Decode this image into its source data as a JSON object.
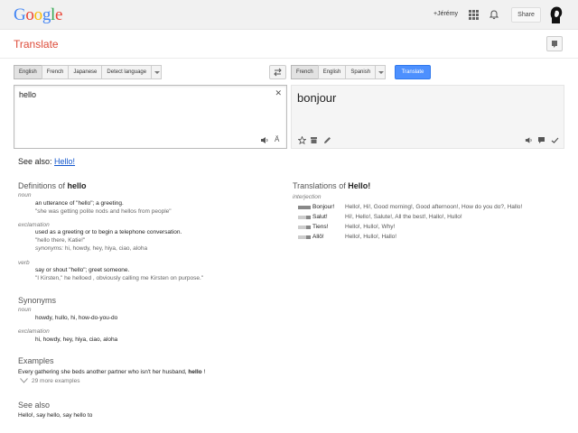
{
  "topbar": {
    "logo_letters": [
      {
        "ch": "G",
        "color": "#4285f4"
      },
      {
        "ch": "o",
        "color": "#ea4335"
      },
      {
        "ch": "o",
        "color": "#fbbc05"
      },
      {
        "ch": "g",
        "color": "#4285f4"
      },
      {
        "ch": "l",
        "color": "#34a853"
      },
      {
        "ch": "e",
        "color": "#ea4335"
      }
    ],
    "user_link": "+Jérémy",
    "share_label": "Share"
  },
  "header": {
    "title": "Translate"
  },
  "source_langs": [
    "English",
    "French",
    "Japanese",
    "Detect language"
  ],
  "target_langs": [
    "French",
    "English",
    "Spanish"
  ],
  "translate_label": "Translate",
  "source": {
    "text": "hello"
  },
  "result": {
    "text": "bonjour"
  },
  "see_also_top": {
    "label": "See also:",
    "link": "Hello!"
  },
  "definitions": {
    "title_prefix": "Definitions of",
    "word": "hello",
    "entries": [
      {
        "pos": "noun",
        "def": "an utterance of \"hello\"; a greeting.",
        "example": "\"she was getting polite nods and hellos from people\""
      },
      {
        "pos": "exclamation",
        "def": "used as a greeting or to begin a telephone conversation.",
        "example": "\"hello there, Katie!\"",
        "synonyms_label": "synonyms:",
        "synonyms": "hi, howdy, hey, hiya, ciao, aloha"
      },
      {
        "pos": "verb",
        "def": "say or shout \"hello\"; greet someone.",
        "example": "\"I Kirsten,\" he helloed , obviously calling me Kirsten on purpose.\""
      }
    ]
  },
  "synonyms": {
    "title": "Synonyms",
    "groups": [
      {
        "pos": "noun",
        "words": "howdy, hullo, hi, how-do-you-do"
      },
      {
        "pos": "exclamation",
        "words": "hi, howdy, hey, hiya, ciao, aloha"
      }
    ]
  },
  "examples": {
    "title": "Examples",
    "text_before": "Every gathering she beds another partner who isn't her husband, ",
    "text_bold": "hello",
    "text_after": " !",
    "more": "29 more examples"
  },
  "see_also_bottom": {
    "title": "See also",
    "text": "Hello!, say hello, say hello to"
  },
  "translations": {
    "title_prefix": "Translations of",
    "word": "Hello!",
    "pos": "interjection",
    "rows": [
      {
        "word": "Bonjour!",
        "back": "Hello!, Hi!, Good morning!, Good afternoon!, How do you do?, Hallo!",
        "freq": 3
      },
      {
        "word": "Salut!",
        "back": "Hi!, Hello!, Salute!, All the best!, Hallo!, Hullo!",
        "freq": 1
      },
      {
        "word": "Tiens!",
        "back": "Hello!, Hullo!, Why!",
        "freq": 1
      },
      {
        "word": "Allô!",
        "back": "Hello!, Hullo!, Hallo!",
        "freq": 1
      }
    ]
  },
  "colors": {
    "accent_red": "#dd4b39",
    "link_blue": "#1155cc",
    "button_blue": "#4d90fe"
  }
}
